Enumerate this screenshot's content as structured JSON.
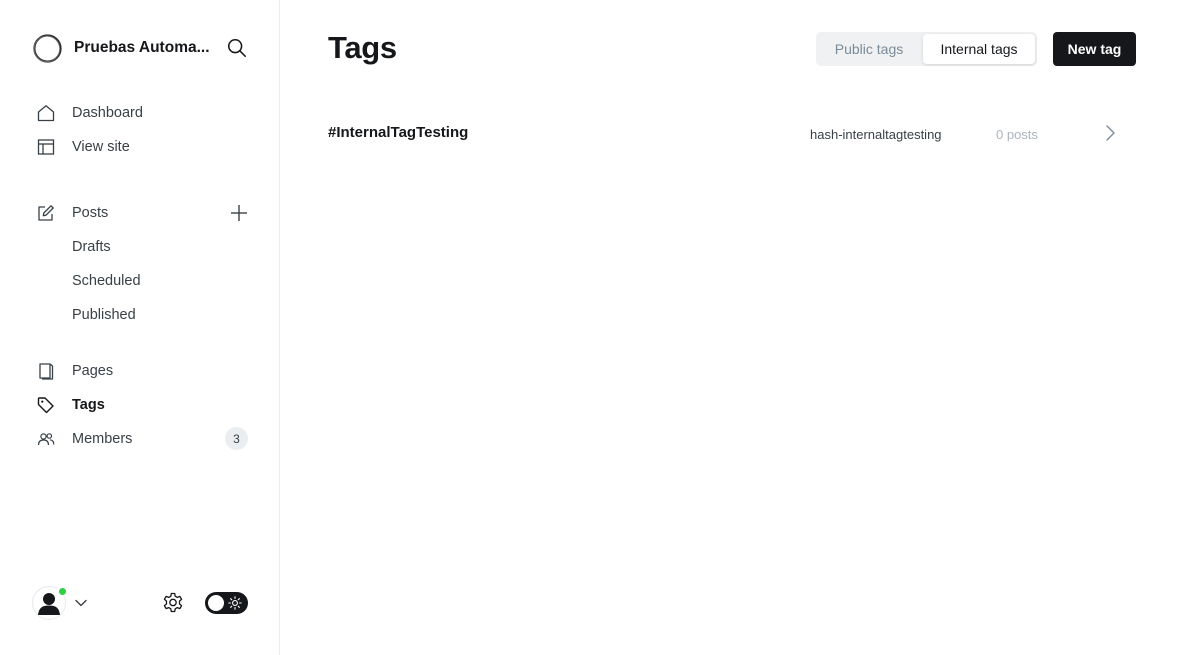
{
  "sidebar": {
    "site_name": "Pruebas Automa...",
    "nav_main": [
      {
        "label": "Dashboard",
        "icon": "home-icon"
      },
      {
        "label": "View site",
        "icon": "layout-icon"
      }
    ],
    "posts": {
      "label": "Posts",
      "icon": "pencil-icon",
      "sub": [
        {
          "label": "Drafts"
        },
        {
          "label": "Scheduled"
        },
        {
          "label": "Published"
        }
      ]
    },
    "nav_bottom": [
      {
        "label": "Pages",
        "icon": "page-icon"
      },
      {
        "label": "Tags",
        "icon": "tag-icon",
        "active": true
      },
      {
        "label": "Members",
        "icon": "members-icon",
        "count": "3"
      }
    ]
  },
  "main": {
    "title": "Tags",
    "tabs": [
      {
        "label": "Public tags",
        "selected": false
      },
      {
        "label": "Internal tags",
        "selected": true
      }
    ],
    "new_button": "New tag",
    "tags": [
      {
        "name": "#InternalTagTesting",
        "slug": "hash-internaltagtesting",
        "count": "0 posts"
      }
    ]
  },
  "colors": {
    "accent": "#15171a",
    "online": "#30cf43",
    "muted": "#7c8b9a"
  }
}
